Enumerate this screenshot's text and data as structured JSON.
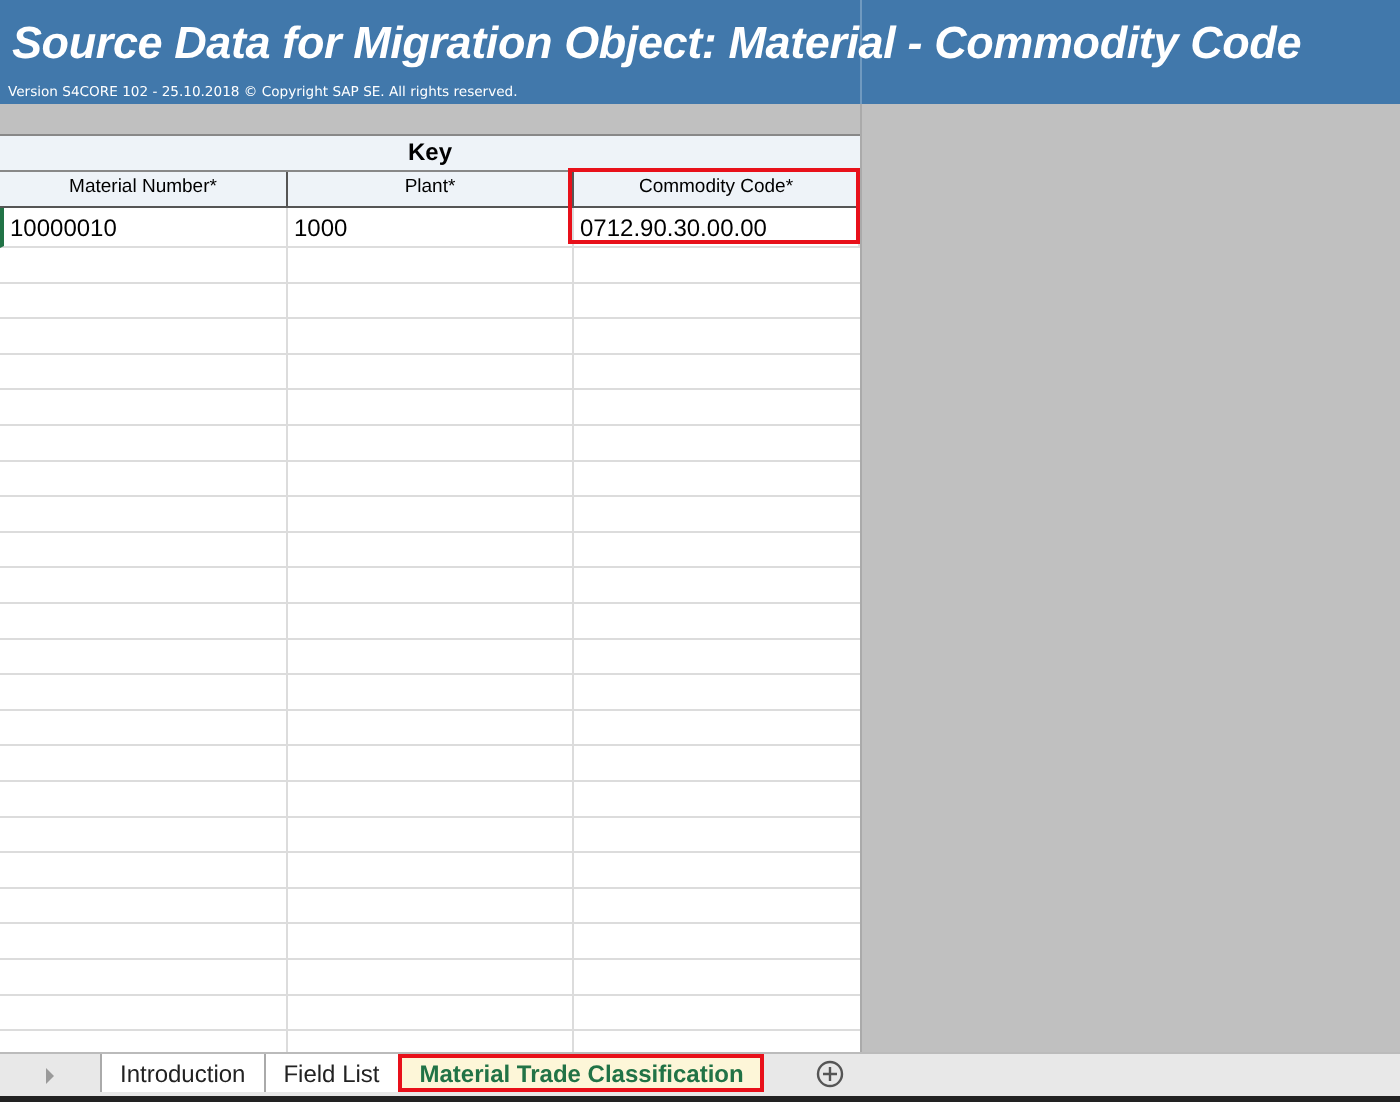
{
  "header": {
    "title": "Source Data for Migration Object:  Material - Commodity Code",
    "version": "Version S4CORE 102  - 25.10.2018 © Copyright SAP SE. All rights reserved."
  },
  "table": {
    "group": "Key",
    "columns": [
      {
        "label": "Material Number*",
        "highlighted": false
      },
      {
        "label": "Plant*",
        "highlighted": false
      },
      {
        "label": "Commodity Code*",
        "highlighted": true
      }
    ],
    "rows": [
      [
        "10000010",
        "1000",
        "0712.90.30.00.00"
      ]
    ]
  },
  "sheet_tabs": [
    {
      "label": "Introduction",
      "selected": false,
      "highlighted": false
    },
    {
      "label": "Field List",
      "selected": false,
      "highlighted": false
    },
    {
      "label": "Material Trade Classification",
      "selected": true,
      "highlighted": true
    }
  ]
}
